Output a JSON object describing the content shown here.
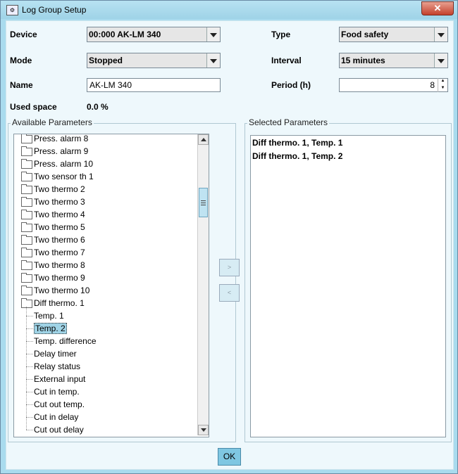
{
  "window": {
    "title": "Log Group Setup",
    "close_glyph": "✕"
  },
  "form": {
    "device_label": "Device",
    "device_value": "00:000 AK-LM 340",
    "type_label": "Type",
    "type_value": "Food safety",
    "mode_label": "Mode",
    "mode_value": "Stopped",
    "interval_label": "Interval",
    "interval_value": "15 minutes",
    "name_label": "Name",
    "name_value": "AK-LM 340",
    "period_label": "Period (h)",
    "period_value": "8",
    "used_space_label": "Used space",
    "used_space_value": "0.0 %"
  },
  "available": {
    "title": "Available Parameters",
    "folders": [
      "Press. alarm 8",
      "Press. alarm 9",
      "Press. alarm 10",
      "Two sensor th 1",
      "Two thermo 2",
      "Two thermo 3",
      "Two thermo 4",
      "Two thermo 5",
      "Two thermo 6",
      "Two thermo 7",
      "Two thermo 8",
      "Two thermo 9",
      "Two thermo 10",
      "Diff thermo. 1"
    ],
    "children": [
      "Temp. 1",
      "Temp. 2",
      "Temp. difference",
      "Delay timer",
      "Relay status",
      "External input",
      "Cut in temp.",
      "Cut out temp.",
      "Cut in delay",
      "Cut out delay"
    ],
    "selected_child": "Temp. 2"
  },
  "selected": {
    "title": "Selected Parameters",
    "items": [
      "Diff thermo. 1, Temp. 1",
      "Diff thermo. 1, Temp. 2"
    ]
  },
  "buttons": {
    "add": ">",
    "remove": "<",
    "ok": "OK"
  },
  "colors": {
    "window_bg": "#a9dbee",
    "client_bg": "#eef8fc",
    "selection": "#9fd3e6",
    "ok_button": "#7fc7e2"
  }
}
